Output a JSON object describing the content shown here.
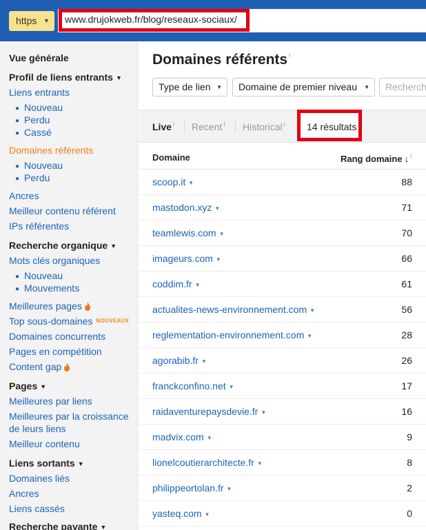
{
  "address_bar": {
    "protocol": "https",
    "url": "www.drujokweb.fr/blog/reseaux-sociaux/"
  },
  "sidebar": {
    "overview": "Vue générale",
    "backlink_profile": {
      "heading": "Profil de liens entrants",
      "backlinks": "Liens entrants",
      "backlinks_sub": [
        "Nouveau",
        "Perdu",
        "Cassé"
      ],
      "referring_domains": "Domaines référents",
      "referring_domains_sub": [
        "Nouveau",
        "Perdu"
      ],
      "anchors": "Ancres",
      "best_by_links": "Meilleur contenu référent",
      "referring_ips": "IPs référentes"
    },
    "organic_search": {
      "heading": "Recherche organique",
      "organic_keywords": "Mots clés organiques",
      "organic_keywords_sub": [
        "Nouveau",
        "Mouvements"
      ],
      "top_pages": "Meilleures pages",
      "top_subdomains": "Top sous-domaines",
      "new_badge": "NOUVEAUX",
      "competing_domains": "Domaines concurrents",
      "competing_pages": "Pages en compétition",
      "content_gap": "Content gap"
    },
    "pages": {
      "heading": "Pages",
      "best_by_links": "Meilleures par liens",
      "best_by_growth_line1": "Meilleures par la croissance",
      "best_by_growth_line2": "de leurs liens",
      "top_content": "Meilleur contenu"
    },
    "outgoing": {
      "heading": "Liens sortants",
      "linked_domains": "Domaines liés",
      "anchors": "Ancres",
      "broken_links": "Liens cassés"
    },
    "paid_search": {
      "heading": "Recherche payante"
    }
  },
  "main": {
    "title": "Domaines référents",
    "info_mark": "i",
    "filters": {
      "link_type": "Type de lien",
      "tld": "Domaine de premier niveau",
      "search_placeholder": "Recherche"
    },
    "tabs": {
      "live": "Live",
      "recent": "Recent",
      "historical": "Historical",
      "results": "14 résultats"
    },
    "table": {
      "col_domain": "Domaine",
      "col_dr": "Rang domaine",
      "sort_mark": "↓",
      "rows": [
        {
          "domain": "scoop.it",
          "dr": "88"
        },
        {
          "domain": "mastodon.xyz",
          "dr": "71"
        },
        {
          "domain": "teamlewis.com",
          "dr": "70"
        },
        {
          "domain": "imageurs.com",
          "dr": "66"
        },
        {
          "domain": "coddim.fr",
          "dr": "61"
        },
        {
          "domain": "actualites-news-environnement.com",
          "dr": "56"
        },
        {
          "domain": "reglementation-environnement.com",
          "dr": "28"
        },
        {
          "domain": "agorabib.fr",
          "dr": "26"
        },
        {
          "domain": "franckconfino.net",
          "dr": "17"
        },
        {
          "domain": "raidaventurepaysdevie.fr",
          "dr": "16"
        },
        {
          "domain": "madvix.com",
          "dr": "9"
        },
        {
          "domain": "lionelcoutierarchitecte.fr",
          "dr": "8"
        },
        {
          "domain": "philippeortolan.fr",
          "dr": "2"
        },
        {
          "domain": "yasteq.com",
          "dr": "0"
        }
      ]
    }
  },
  "colors": {
    "topbar": "#1e5fb4",
    "link": "#1a63b8",
    "active": "#f07c1b",
    "highlight": "#e10015",
    "protocol_bg": "#f7e28d"
  }
}
